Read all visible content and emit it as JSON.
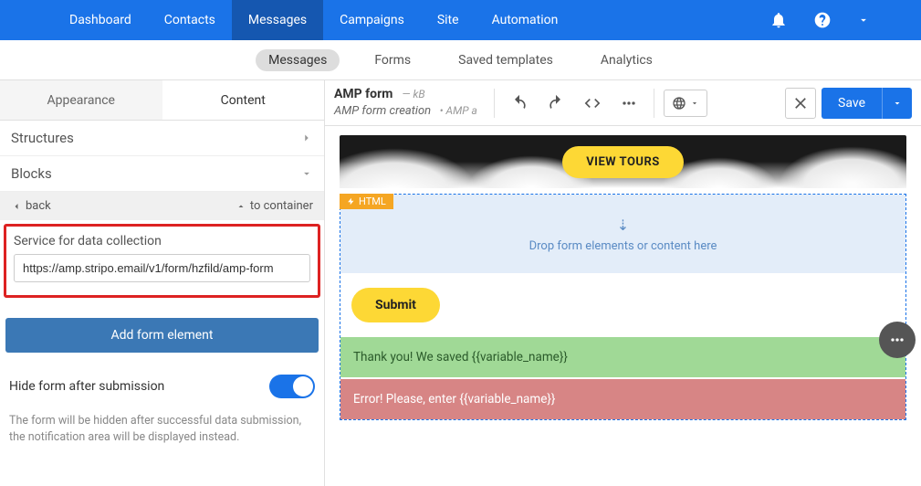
{
  "topnav": {
    "items": [
      "Dashboard",
      "Contacts",
      "Messages",
      "Campaigns",
      "Site",
      "Automation"
    ],
    "active_index": 2
  },
  "subnav": {
    "items": [
      "Messages",
      "Forms",
      "Saved templates",
      "Analytics"
    ],
    "active_index": 0
  },
  "left_tabs": {
    "appearance": "Appearance",
    "content": "Content"
  },
  "sections": {
    "structures": "Structures",
    "blocks": "Blocks"
  },
  "breadcrumb": {
    "back": "back",
    "to_container": "to container"
  },
  "service_field": {
    "label": "Service for data collection",
    "value": "https://amp.stripo.email/v1/form/hzfild/amp-form"
  },
  "add_button": "Add form element",
  "hide_toggle": {
    "label": "Hide form after submission",
    "help": "The form will be hidden after successful data submission, the notification area will be displayed instead.",
    "on": true
  },
  "doc": {
    "title": "AMP form",
    "size": "— kB",
    "subtitle": "AMP form creation",
    "amp_note": "AMP a"
  },
  "save_label": "Save",
  "canvas": {
    "hero_button": "VIEW TOURS",
    "html_badge": "HTML",
    "drop_text": "Drop form elements or content here",
    "submit_label": "Submit",
    "success_msg": "Thank you! We saved {{variable_name}}",
    "error_msg": "Error! Please, enter {{variable_name}}"
  },
  "colors": {
    "primary": "#1a73e8",
    "accent_yellow": "#fdd835",
    "success_bg": "#a0d996",
    "error_bg": "#d78585",
    "highlight_border": "#d22"
  }
}
